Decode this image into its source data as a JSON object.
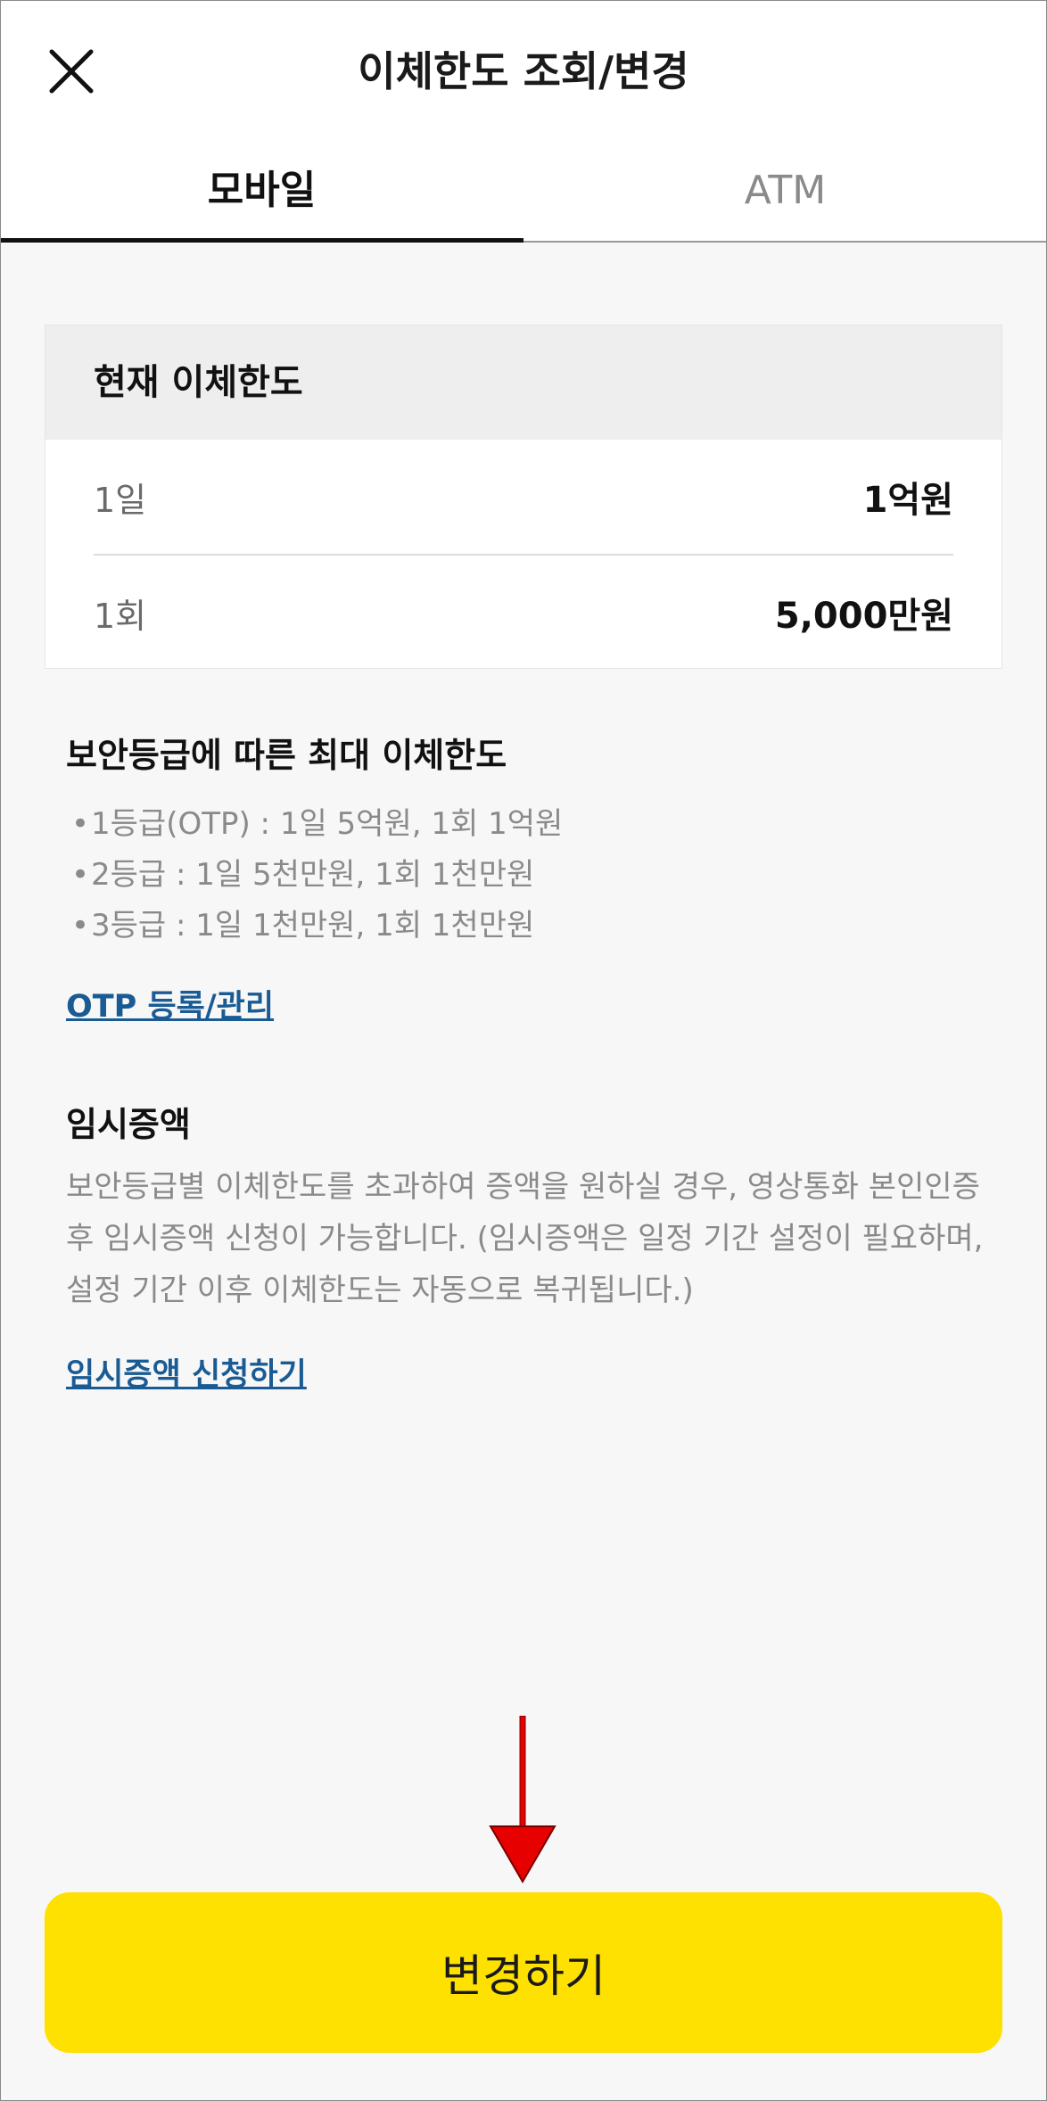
{
  "header": {
    "title": "이체한도 조회/변경",
    "close_icon": "close-icon"
  },
  "tabs": [
    {
      "label": "모바일",
      "active": true
    },
    {
      "label": "ATM",
      "active": false
    }
  ],
  "current_limit": {
    "heading": "현재 이체한도",
    "rows": [
      {
        "label": "1일",
        "value": "1억원"
      },
      {
        "label": "1회",
        "value": "5,000만원"
      }
    ]
  },
  "security_section": {
    "title": "보안등급에 따른 최대 이체한도",
    "bullets": [
      "1등급(OTP) : 1일 5억원, 1회 1억원",
      "2등급 : 1일 5천만원, 1회 1천만원",
      "3등급 : 1일 1천만원, 1회 1천만원"
    ],
    "link": "OTP 등록/관리"
  },
  "temporary_section": {
    "title": "임시증액",
    "description": "보안등급별 이체한도를 초과하여 증액을 원하실 경우, 영상통화 본인인증 후 임시증액 신청이 가능합니다. (임시증액은 일정 기간 설정이 필요하며, 설정 기간 이후 이체한도는 자동으로 복귀됩니다.)",
    "link": "임시증액 신청하기"
  },
  "footer": {
    "button_label": "변경하기"
  },
  "colors": {
    "accent_button": "#fee100",
    "link": "#1b5b94",
    "arrow": "#e60000"
  }
}
